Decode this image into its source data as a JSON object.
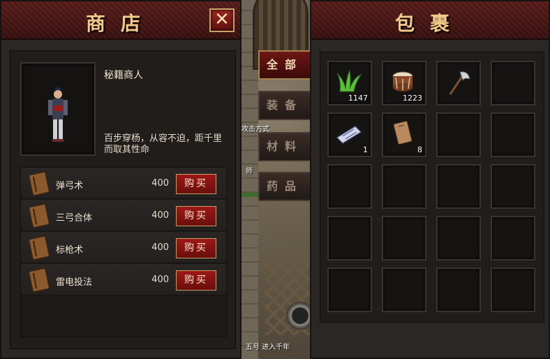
{
  "shop": {
    "title": "商店",
    "npc_name": "秘籍商人",
    "npc_desc": "百步穿杨，从容不迫，距千里而取其性命",
    "buy_label": "购买",
    "items": [
      {
        "name": "弹弓术",
        "price": "400"
      },
      {
        "name": "三弓合体",
        "price": "400"
      },
      {
        "name": "标枪术",
        "price": "400"
      },
      {
        "name": "雷电投法",
        "price": "400"
      }
    ]
  },
  "categories": [
    "全部",
    "装备",
    "材料",
    "药品"
  ],
  "active_category": "全部",
  "scene": {
    "text_1": "攻击方式",
    "text_2": "师",
    "text_3": "五号 进入千年"
  },
  "bag": {
    "title": "包裹",
    "slots": [
      {
        "icon": "grass-icon",
        "count": "1147"
      },
      {
        "icon": "drum-icon",
        "count": "1223"
      },
      {
        "icon": "axe-icon",
        "count": ""
      },
      {
        "icon": "",
        "count": ""
      },
      {
        "icon": "scroll-icon",
        "count": "1"
      },
      {
        "icon": "book-icon",
        "count": "8"
      }
    ]
  },
  "colors": {
    "header_red": "#5b1e1c",
    "title_gold": "#f2c98a",
    "button_red": "#9d1816"
  }
}
